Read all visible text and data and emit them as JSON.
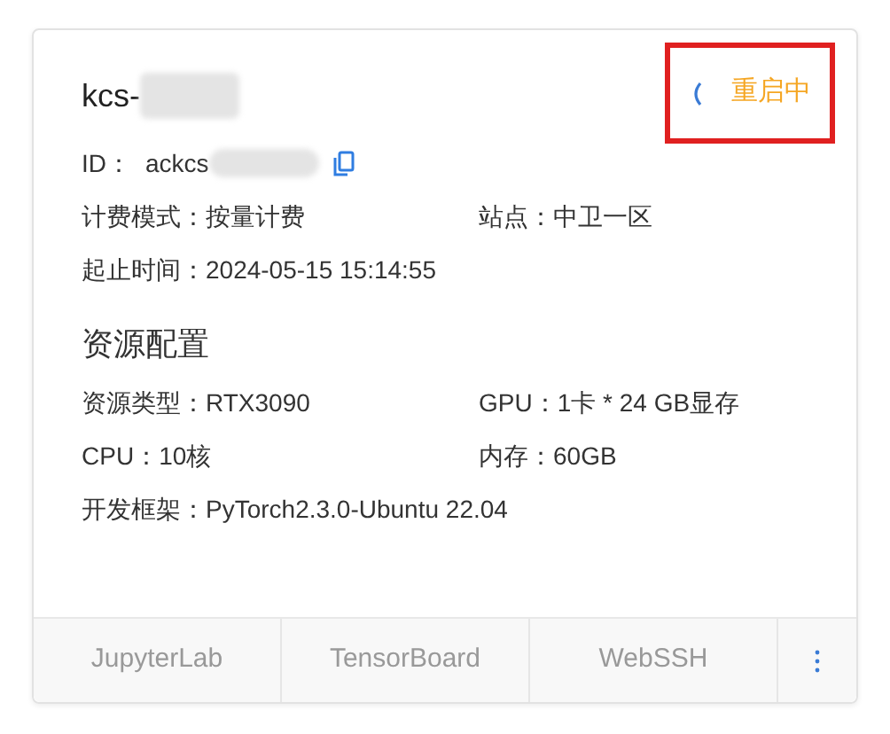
{
  "card": {
    "name": "kcs-",
    "id_label": "ID：",
    "id_value": "ackcs",
    "status": {
      "text": "重启中",
      "loading": true,
      "highlighted": true
    },
    "info": [
      [
        {
          "label": "计费模式：",
          "value": "按量计费"
        },
        {
          "label": "站点：",
          "value": "中卫一区"
        }
      ],
      [
        {
          "label": "起止时间：",
          "value": "2024-05-15 15:14:55"
        }
      ]
    ],
    "section_title": "资源配置",
    "resources": [
      [
        {
          "label": "资源类型：",
          "value": "RTX3090"
        },
        {
          "label": "GPU：",
          "value": "1卡 * 24 GB显存"
        }
      ],
      [
        {
          "label": "CPU：",
          "value": "10核"
        },
        {
          "label": "内存：",
          "value": "60GB"
        }
      ],
      [
        {
          "label": "开发框架：",
          "value": "PyTorch2.3.0-Ubuntu 22.04"
        }
      ]
    ],
    "actions": [
      "JupyterLab",
      "TensorBoard",
      "WebSSH"
    ]
  }
}
